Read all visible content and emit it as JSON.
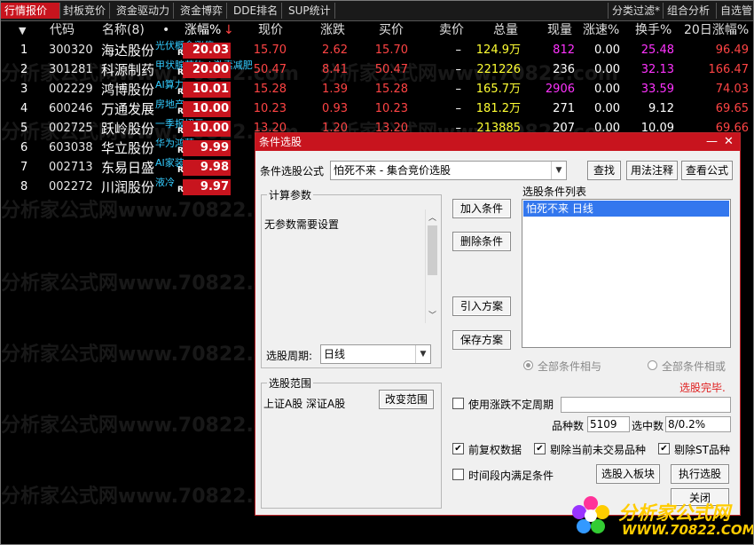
{
  "tabs": {
    "left": [
      "行情报价",
      "封板竞价",
      "资金驱动力",
      "资金博弈",
      "DDE排名",
      "SUP统计"
    ],
    "right": [
      "分类过滤*",
      "组合分析",
      "自选管"
    ]
  },
  "columns": {
    "arrow": "▼",
    "code": "代码",
    "name": "名称(8)",
    "dot": "•",
    "pct": "涨幅%",
    "pct_sort": "↓",
    "price": "现价",
    "change": "涨跌",
    "bid": "买价",
    "ask": "卖价",
    "volume": "总量",
    "cur": "现量",
    "speed": "涨速%",
    "turnover": "换手%",
    "d20": "20日涨幅%"
  },
  "rows": [
    {
      "idx": "1",
      "code": "300320",
      "name": "海达股份",
      "tag": "光伏概念涨停",
      "r": "R",
      "pct": "20.03",
      "price": "15.70",
      "change": "2.62",
      "bid": "15.70",
      "ask": "–",
      "vol": "124.9万",
      "cur": "812",
      "speed": "0.00",
      "turn": "25.48",
      "d20": "96.49"
    },
    {
      "idx": "2",
      "code": "301281",
      "name": "科源制药",
      "tag": "甲状腺药物 / 激素减肥",
      "r": "R",
      "pct": "20.00",
      "price": "50.47",
      "change": "8.41",
      "bid": "50.47",
      "ask": "–",
      "vol": "221226",
      "cur": "236",
      "speed": "0.00",
      "turn": "32.13",
      "d20": "166.47"
    },
    {
      "idx": "3",
      "code": "002229",
      "name": "鸿博股份",
      "tag": "AI算力",
      "r": "R",
      "pct": "10.01",
      "price": "15.28",
      "change": "1.39",
      "bid": "15.28",
      "ask": "–",
      "vol": "165.7万",
      "cur": "2906",
      "speed": "0.00",
      "turn": "33.59",
      "d20": "74.03"
    },
    {
      "idx": "4",
      "code": "600246",
      "name": "万通发展",
      "tag": "房地产",
      "r": "R",
      "pct": "10.00",
      "price": "10.23",
      "change": "0.93",
      "bid": "10.23",
      "ask": "–",
      "vol": "181.2万",
      "cur": "271",
      "speed": "0.00",
      "turn": "9.12",
      "d20": "69.65"
    },
    {
      "idx": "5",
      "code": "002725",
      "name": "跃岭股份",
      "tag": "一季报扭亏",
      "r": "R",
      "pct": "10.00",
      "price": "13.20",
      "change": "1.20",
      "bid": "13.20",
      "ask": "–",
      "vol": "213885",
      "cur": "207",
      "speed": "0.00",
      "turn": "10.09",
      "d20": "69.66"
    },
    {
      "idx": "6",
      "code": "603038",
      "name": "华立股份",
      "tag": "华为鸿蒙",
      "r": "R",
      "pct": "9.99",
      "price": "",
      "change": "",
      "bid": "",
      "ask": "",
      "vol": "",
      "cur": "",
      "speed": "",
      "turn": "",
      "d20": ""
    },
    {
      "idx": "7",
      "code": "002713",
      "name": "东易日盛",
      "tag": "AI家装",
      "r": "R",
      "pct": "9.98",
      "price": "",
      "change": "",
      "bid": "",
      "ask": "",
      "vol": "",
      "cur": "",
      "speed": "",
      "turn": "",
      "d20": ""
    },
    {
      "idx": "8",
      "code": "002272",
      "name": "川润股份",
      "tag": "液冷",
      "r": "R",
      "pct": "9.97",
      "price": "",
      "change": "",
      "bid": "",
      "ask": "",
      "vol": "",
      "cur": "",
      "speed": "",
      "turn": "",
      "d20": ""
    }
  ],
  "watermark": "分析家公式网www.70822.com",
  "dialog": {
    "title": "条件选股",
    "min": "—",
    "close": "✕",
    "formula_label": "条件选股公式",
    "formula_value": "怕死不来  -  集合竞价选股",
    "btn_find": "查找",
    "btn_usage": "用法注释",
    "btn_view": "查看公式",
    "params_title": "计算参数",
    "params_text": "无参数需要设置",
    "period_label": "选股周期:",
    "period_value": "日线",
    "range_title": "选股范围",
    "range_text": "上证A股 深证A股",
    "btn_range": "改变范围",
    "btn_add": "加入条件",
    "btn_del": "删除条件",
    "btn_import": "引入方案",
    "btn_save": "保存方案",
    "list_title": "选股条件列表",
    "list_item": "怕死不来  日线",
    "radio_and": "全部条件相与",
    "radio_or": "全部条件相或",
    "status": "选股完毕.",
    "cb_uncertain": "使用涨跌不定周期",
    "stock_count_label": "品种数",
    "stock_count": "5109",
    "selected_label": "选中数",
    "selected": "8/0.2%",
    "cb_prefq": "前复权数据",
    "cb_notrade": "剔除当前未交易品种",
    "cb_st": "剔除ST品种",
    "cb_time": "时间段内满足条件",
    "btn_toblock": "选股入板块",
    "btn_run": "执行选股",
    "btn_close": "关闭"
  },
  "logo": {
    "line1": "分析家公式网",
    "line2": "WWW.70822.COM"
  }
}
